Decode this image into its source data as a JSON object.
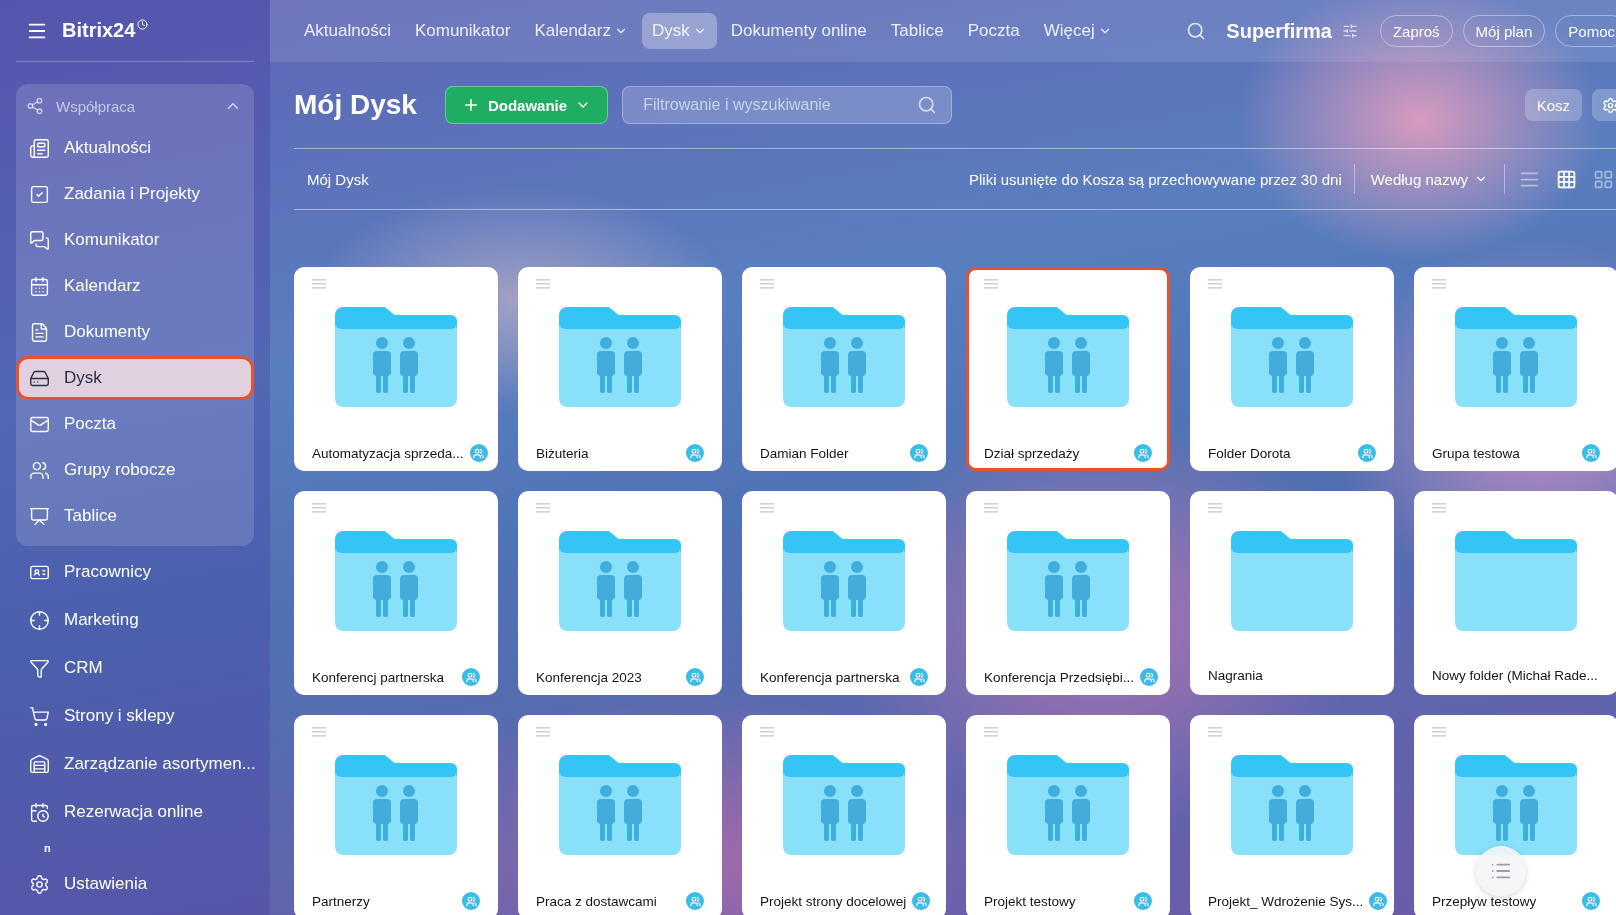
{
  "sidebar": {
    "logo": "Bitrix24",
    "group": {
      "label": "Współpraca",
      "expanded": true,
      "children": [
        {
          "label": "Aktualności",
          "selected": false
        },
        {
          "label": "Zadania i Projekty",
          "selected": false
        },
        {
          "label": "Komunikator",
          "selected": false
        },
        {
          "label": "Kalendarz",
          "selected": false
        },
        {
          "label": "Dokumenty",
          "selected": false
        },
        {
          "label": "Dysk",
          "selected": true
        },
        {
          "label": "Poczta",
          "selected": false
        },
        {
          "label": "Grupy robocze",
          "selected": false
        },
        {
          "label": "Tablice",
          "selected": false
        }
      ]
    },
    "items": [
      {
        "label": "Pracownicy",
        "selected": false
      },
      {
        "label": "Marketing",
        "selected": false
      },
      {
        "label": "CRM",
        "selected": false
      },
      {
        "label": "Strony i sklepy",
        "selected": false
      },
      {
        "label": "Zarządzanie asortymen...",
        "selected": false
      },
      {
        "label": "Rezerwacja online",
        "selected": false
      }
    ],
    "note": "n",
    "footer_item": {
      "label": "Ustawienia",
      "selected": false
    }
  },
  "top_nav": [
    {
      "label": "Aktualności",
      "selected": false,
      "dropdown": false
    },
    {
      "label": "Komunikator",
      "selected": false,
      "dropdown": false
    },
    {
      "label": "Kalendarz",
      "selected": false,
      "dropdown": true
    },
    {
      "label": "Dysk",
      "selected": true,
      "dropdown": true
    },
    {
      "label": "Dokumenty online",
      "selected": false,
      "dropdown": false
    },
    {
      "label": "Tablice",
      "selected": false,
      "dropdown": false
    },
    {
      "label": "Poczta",
      "selected": false,
      "dropdown": false
    },
    {
      "label": "Więcej",
      "selected": false,
      "dropdown": true
    }
  ],
  "header_right": {
    "company": "Superfirma",
    "buttons": [
      "Zaproś",
      "Mój plan",
      "Pomoc"
    ]
  },
  "page": {
    "title": "Mój Dysk",
    "add_button": "Dodawanie",
    "search": {
      "placeholder": "Filtrowanie i wyszukiwanie"
    },
    "trash_button": "Kosz"
  },
  "toolbar": {
    "breadcrumb": "Mój Dysk",
    "notice": "Pliki usunięte do Kosza są przechowywane przez 30 dni",
    "sort": "Według nazwy",
    "views": [
      {
        "kind": "list",
        "selected": false
      },
      {
        "kind": "grid",
        "selected": true
      },
      {
        "kind": "tiles",
        "selected": false
      }
    ]
  },
  "folders": [
    {
      "name": "Automatyzacja sprzeda...",
      "shared": true,
      "selected": false
    },
    {
      "name": "Biżuteria",
      "shared": true,
      "selected": false
    },
    {
      "name": "Damian Folder",
      "shared": true,
      "selected": false
    },
    {
      "name": "Dział sprzedaży",
      "shared": true,
      "selected": true
    },
    {
      "name": "Folder Dorota",
      "shared": true,
      "selected": false
    },
    {
      "name": "Grupa testowa",
      "shared": true,
      "selected": false
    },
    {
      "name": "Konferencj partnerska",
      "shared": true,
      "selected": false
    },
    {
      "name": "Konferencja 2023",
      "shared": true,
      "selected": false
    },
    {
      "name": "Konferencja partnerska",
      "shared": true,
      "selected": false
    },
    {
      "name": "Konferencja Przedsiębi...",
      "shared": true,
      "selected": false
    },
    {
      "name": "Nagrania",
      "shared": false,
      "selected": false
    },
    {
      "name": "Nowy folder (Michał Rade...",
      "shared": false,
      "selected": false
    },
    {
      "name": "Partnerzy",
      "shared": true,
      "selected": false
    },
    {
      "name": "Praca z dostawcami",
      "shared": true,
      "selected": false
    },
    {
      "name": "Projekt strony docelowej",
      "shared": true,
      "selected": false
    },
    {
      "name": "Projekt testowy",
      "shared": true,
      "selected": false
    },
    {
      "name": "Projekt_ Wdrożenie Sys...",
      "shared": true,
      "selected": false
    },
    {
      "name": "Przepływ testowy",
      "shared": true,
      "selected": false
    }
  ]
}
